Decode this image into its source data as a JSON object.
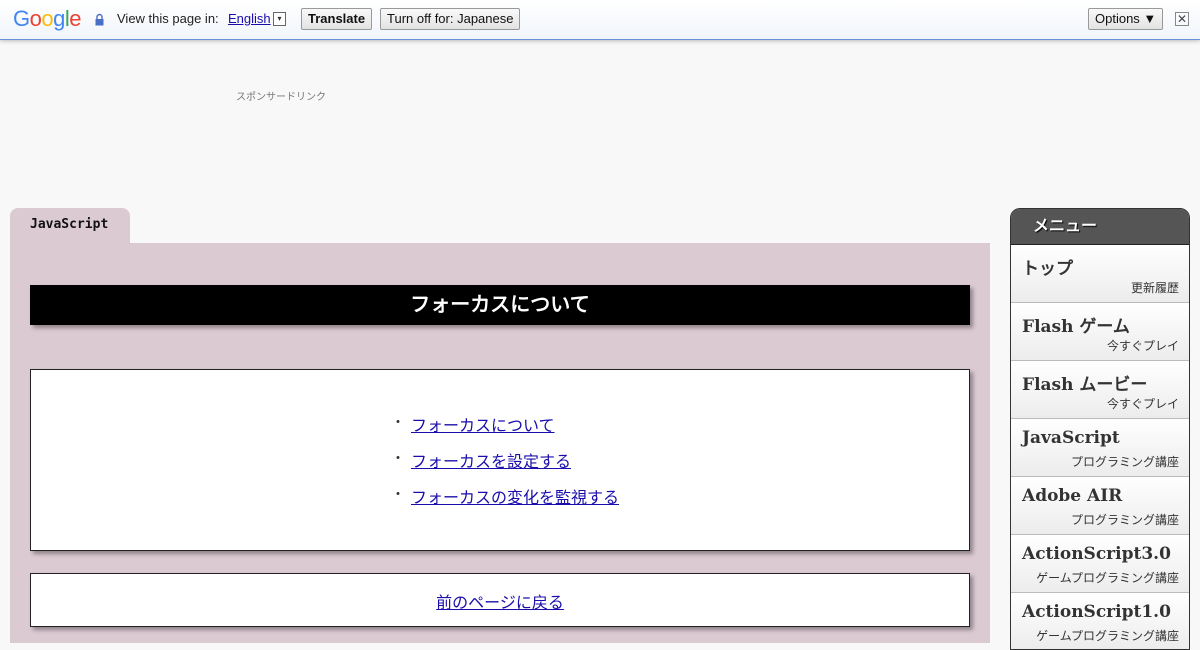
{
  "translate_bar": {
    "logo_letters": [
      "G",
      "o",
      "o",
      "g",
      "l",
      "e"
    ],
    "logo_colors": [
      "#4285f4",
      "#ea4335",
      "#fbbc05",
      "#4285f4",
      "#34a853",
      "#ea4335"
    ],
    "label": "View this page in:",
    "language": "English",
    "language_arrow": "▾",
    "translate_button": "Translate",
    "turn_off_button": "Turn off for: Japanese",
    "options_button": "Options ▼",
    "close_glyph": "✕"
  },
  "sponsor_label": "スポンサードリンク",
  "tab_label": "JavaScript",
  "page_title": "フォーカスについて",
  "toc": {
    "bullet": "・",
    "items": [
      "フォーカスについて",
      "フォーカスを設定する",
      "フォーカスの変化を監視する"
    ]
  },
  "back_link": "前のページに戻る",
  "menu": {
    "header": "メニュー",
    "items": [
      {
        "title": "トップ",
        "sub": "更新履歴"
      },
      {
        "title": "Flash ゲーム",
        "sub": "今すぐプレイ"
      },
      {
        "title": "Flash ムービー",
        "sub": "今すぐプレイ"
      },
      {
        "title": "JavaScript",
        "sub": "プログラミング講座"
      },
      {
        "title": "Adobe AIR",
        "sub": "プログラミング講座"
      },
      {
        "title": "ActionScript3.0",
        "sub": "ゲームプログラミング講座"
      },
      {
        "title": "ActionScript1.0",
        "sub": "ゲームプログラミング講座"
      }
    ]
  },
  "colors": {
    "panel": "#dccad3",
    "link": "#1a0dab",
    "menu_header": "#555555"
  }
}
